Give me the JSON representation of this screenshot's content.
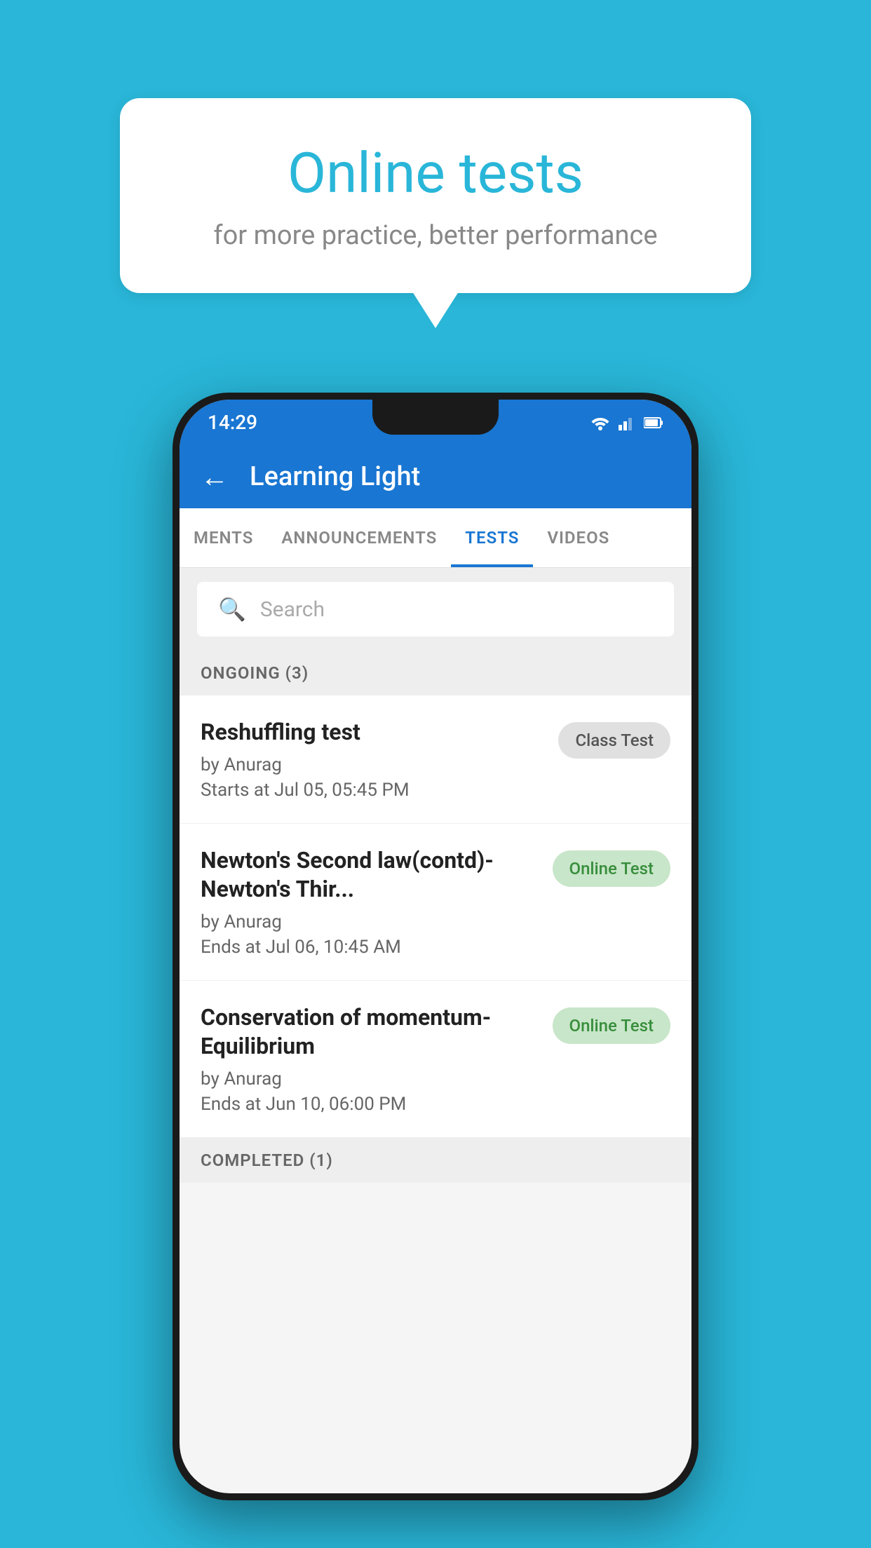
{
  "background_color": "#29b6d8",
  "speech_bubble": {
    "title": "Online tests",
    "subtitle": "for more practice, better performance"
  },
  "phone": {
    "status_bar": {
      "time": "14:29"
    },
    "app_bar": {
      "title": "Learning Light",
      "back_label": "←"
    },
    "tabs": [
      {
        "label": "MENTS",
        "active": false
      },
      {
        "label": "ANNOUNCEMENTS",
        "active": false
      },
      {
        "label": "TESTS",
        "active": true
      },
      {
        "label": "VIDEOS",
        "active": false
      }
    ],
    "search": {
      "placeholder": "Search"
    },
    "ongoing_section": {
      "title": "ONGOING (3)"
    },
    "tests": [
      {
        "name": "Reshuffling test",
        "author": "by Anurag",
        "time_label": "Starts at",
        "time_value": "Jul 05, 05:45 PM",
        "badge": "Class Test",
        "badge_type": "gray"
      },
      {
        "name": "Newton's Second law(contd)-Newton's Thir...",
        "author": "by Anurag",
        "time_label": "Ends at",
        "time_value": "Jul 06, 10:45 AM",
        "badge": "Online Test",
        "badge_type": "green"
      },
      {
        "name": "Conservation of momentum-Equilibrium",
        "author": "by Anurag",
        "time_label": "Ends at",
        "time_value": "Jun 10, 06:00 PM",
        "badge": "Online Test",
        "badge_type": "green"
      }
    ],
    "completed_section": {
      "title": "COMPLETED (1)"
    }
  }
}
